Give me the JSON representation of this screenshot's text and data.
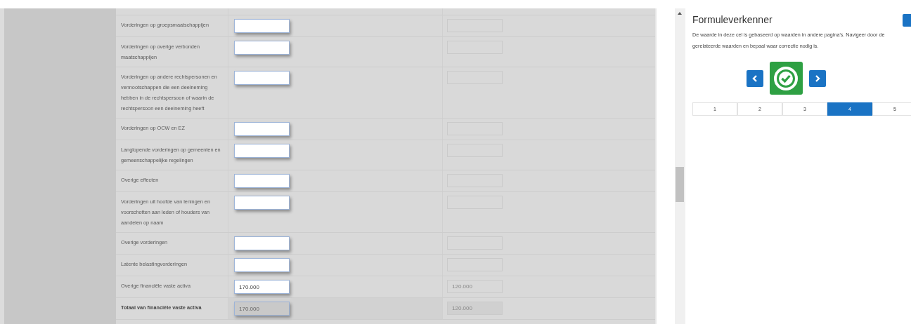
{
  "rows": [
    {
      "kind": "item",
      "label": "Vorderingen op groepsmaatschappijen"
    },
    {
      "kind": "item",
      "label": "Vorderingen op overige verbonden maatschappijen"
    },
    {
      "kind": "item",
      "label": "Vorderingen op andere rechtspersonen en vennootschappen die een deelneming hebben in de rechtspersoon of waarin de rechtspersoon een deelneming heeft"
    },
    {
      "kind": "item",
      "label": "Vorderingen op OCW en EZ"
    },
    {
      "kind": "item",
      "label": "Langlopende vorderingen op gemeenten en gemeenschappelijke regelingen"
    },
    {
      "kind": "item",
      "label": "Overige effecten"
    },
    {
      "kind": "item",
      "label": "Vorderingen uit hoofde van leningen en voorschotten aan leden of houders van aandelen op naam"
    },
    {
      "kind": "item",
      "label": "Overige vorderingen"
    },
    {
      "kind": "item",
      "label": "Latente belastingvorderingen"
    },
    {
      "kind": "item",
      "label": "Overige financiële vaste activa",
      "current": "170.000",
      "prior": "120.000"
    },
    {
      "kind": "total",
      "label": "Totaal van financiële vaste activa",
      "current": "170.000",
      "prior": "120.000"
    }
  ],
  "panel": {
    "title": "Formuleverkenner",
    "description": "De waarde in deze cel is gebaseerd op waarden in andere pagina's. Navigeer door de gerelateerde waarden en bepaal waar correctie nodig is.",
    "pages": [
      {
        "label": "1",
        "selected": false
      },
      {
        "label": "2",
        "selected": false
      },
      {
        "label": "3",
        "selected": false
      },
      {
        "label": "4",
        "selected": true
      },
      {
        "label": "5",
        "selected": false
      }
    ]
  }
}
